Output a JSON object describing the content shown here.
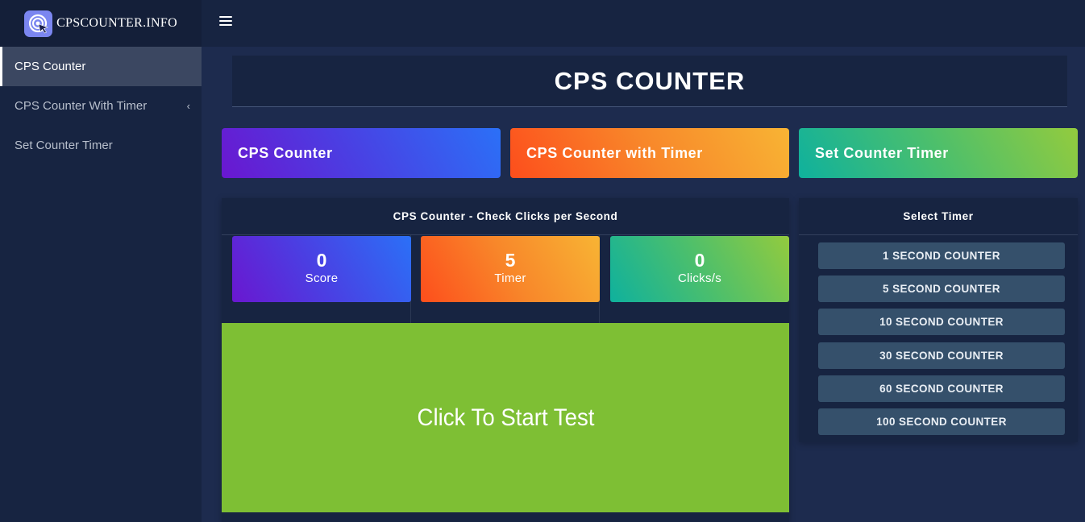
{
  "brand": {
    "name": "CPSCOUNTER.INFO",
    "logo_icon": "target-cursor-icon"
  },
  "sidebar": {
    "items": [
      {
        "label": "CPS Counter",
        "active": true
      },
      {
        "label": "CPS Counter With Timer",
        "has_submenu": true,
        "chevron": "‹"
      },
      {
        "label": "Set Counter Timer"
      }
    ]
  },
  "topbar": {
    "menu_icon": "hamburger-icon"
  },
  "page": {
    "title": "CPS COUNTER"
  },
  "nav_cards": [
    {
      "label": "CPS Counter"
    },
    {
      "label": "CPS Counter with Timer"
    },
    {
      "label": "Set Counter Timer"
    }
  ],
  "counter_panel": {
    "header": "CPS Counter - Check Clicks per Second",
    "stats": [
      {
        "value": "0",
        "label": "Score"
      },
      {
        "value": "5",
        "label": "Timer"
      },
      {
        "value": "0",
        "label": "Clicks/s"
      }
    ],
    "click_area_label": "Click To Start Test"
  },
  "timer_panel": {
    "header": "Select Timer",
    "options": [
      "1 SECOND COUNTER",
      "5 SECOND COUNTER",
      "10 SECOND COUNTER",
      "30 SECOND COUNTER",
      "60 SECOND COUNTER",
      "100 SECOND COUNTER"
    ]
  },
  "colors": {
    "background": "#1d2b4e",
    "sidebar": "#172441",
    "click_area": "#7ebf34",
    "timer_button": "#35506b",
    "purple_blue_gradient": [
      "#6a17d0",
      "#2b70f7"
    ],
    "orange_gradient": [
      "#fd4e1c",
      "#f8b434"
    ],
    "green_gradient": [
      "#0fb19d",
      "#93cb3e"
    ]
  }
}
